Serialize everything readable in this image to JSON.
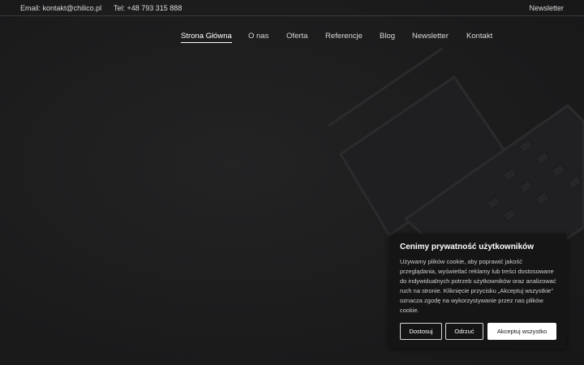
{
  "topbar": {
    "email_label": "Email: kontakt@chilico.pl",
    "phone_label": "Tel: +48 793 315 888",
    "newsletter_label": "Newsletter"
  },
  "nav": {
    "items": [
      {
        "label": "Strona Główna",
        "active": true
      },
      {
        "label": "O nas"
      },
      {
        "label": "Oferta"
      },
      {
        "label": "Referencje"
      },
      {
        "label": "Blog"
      },
      {
        "label": "Newsletter"
      },
      {
        "label": "Kontakt"
      }
    ]
  },
  "cookie": {
    "title": "Cenimy prywatność użytkowników",
    "text": "Używamy plików cookie, aby poprawić jakość przeglądania, wyświetlać reklamy lub treści dostosowane do indywidualnych potrzeb użytkowników oraz analizować ruch na stronie. Kliknięcie przycisku „Akceptuj wszystkie” oznacza zgodę na wykorzystywanie przez nas plików cookie.",
    "customize_label": "Dostosuj",
    "reject_label": "Odrzuć",
    "accept_label": "Akceptuj wszystko"
  },
  "colors": {
    "background": "#1b1b1c",
    "text": "#e6e6e6",
    "dialog_bg": "#151516",
    "accent_button": "#ffffff"
  }
}
